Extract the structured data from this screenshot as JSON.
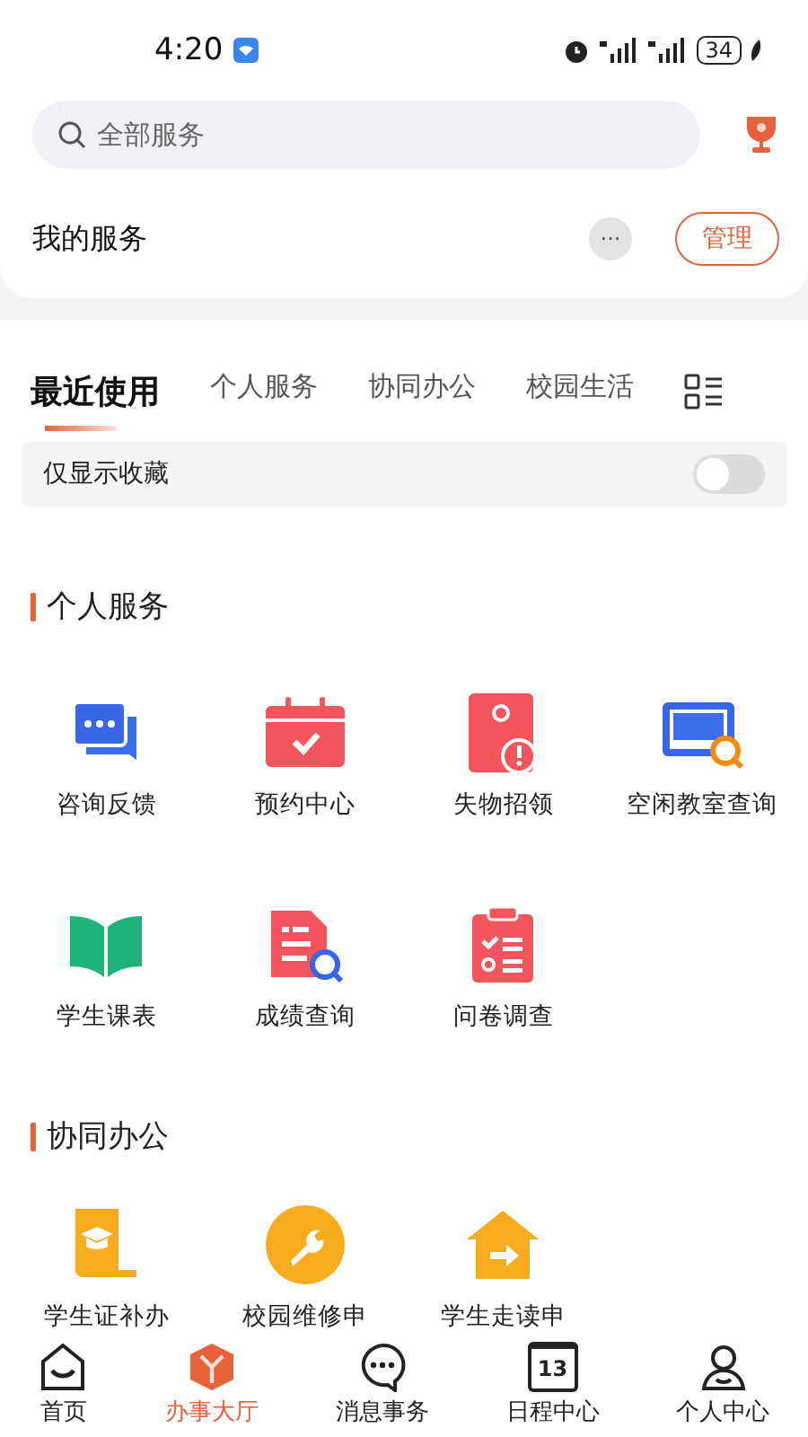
{
  "status_bar": {
    "time": "4:20",
    "battery": "34"
  },
  "search": {
    "placeholder": "全部服务"
  },
  "my_services": {
    "title": "我的服务",
    "more": "···",
    "manage_button": "管理"
  },
  "tabs": [
    {
      "label": "最近使用",
      "selected": true
    },
    {
      "label": "个人服务",
      "selected": false
    },
    {
      "label": "协同办公",
      "selected": false
    },
    {
      "label": "校园生活",
      "selected": false
    }
  ],
  "favorites_filter": {
    "label": "仅显示收藏",
    "on": false
  },
  "sections": [
    {
      "title": "个人服务",
      "items": [
        {
          "label": "咨询反馈"
        },
        {
          "label": "预约中心"
        },
        {
          "label": "失物招领"
        },
        {
          "label": "空闲教室查询"
        },
        {
          "label": "学生课表"
        },
        {
          "label": "成绩查询"
        },
        {
          "label": "问卷调查"
        }
      ]
    },
    {
      "title": "协同办公",
      "items": [
        {
          "label": "学生证补办"
        },
        {
          "label": "校园维修申"
        },
        {
          "label": "学生走读申"
        }
      ]
    }
  ],
  "bottom_nav": [
    {
      "label": "首页",
      "selected": false
    },
    {
      "label": "办事大厅",
      "selected": true
    },
    {
      "label": "消息事务",
      "selected": false
    },
    {
      "label": "日程中心",
      "selected": false,
      "icon_text": "13"
    },
    {
      "label": "个人中心",
      "selected": false
    }
  ]
}
